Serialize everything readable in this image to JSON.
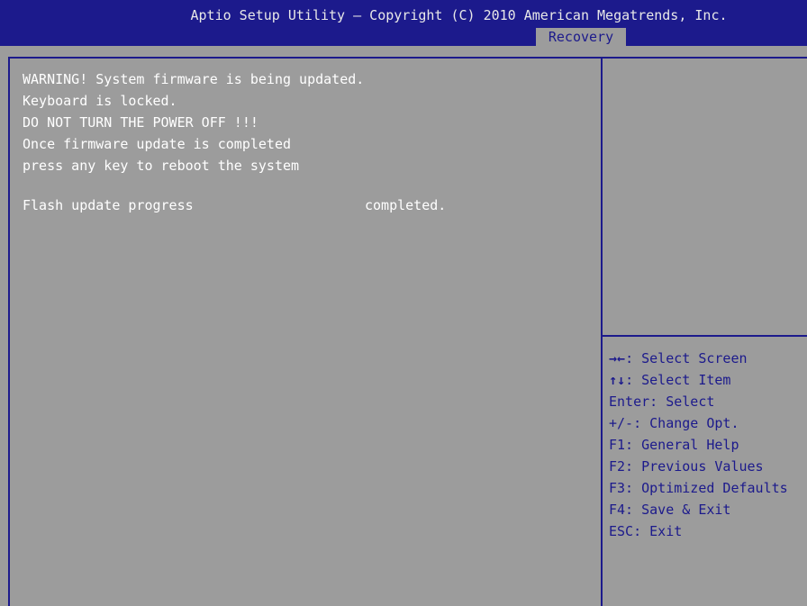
{
  "header": {
    "title": "Aptio Setup Utility – Copyright (C) 2010 American Megatrends, Inc.",
    "active_tab": "Recovery"
  },
  "main": {
    "messages": [
      "WARNING! System firmware is being updated.",
      "Keyboard is locked.",
      "DO NOT TURN THE POWER OFF !!!",
      "Once firmware update is completed",
      "press any key to reboot the system"
    ],
    "progress_label": "Flash update progress",
    "progress_value": "completed."
  },
  "help": {
    "items": [
      {
        "key": "→←",
        "text": ": Select Screen"
      },
      {
        "key": "↑↓",
        "text": ": Select Item"
      },
      {
        "key": "",
        "text": "Enter: Select"
      },
      {
        "key": "",
        "text": "+/-: Change Opt."
      },
      {
        "key": "",
        "text": "F1: General Help"
      },
      {
        "key": "",
        "text": "F2: Previous Values"
      },
      {
        "key": "",
        "text": "F3: Optimized Defaults"
      },
      {
        "key": "",
        "text": "F4: Save & Exit"
      },
      {
        "key": "",
        "text": "ESC: Exit"
      }
    ]
  },
  "colors": {
    "header_bg": "#1c1a8c",
    "panel_bg": "#9c9c9c",
    "main_text": "#ffffff",
    "help_text": "#1c1a8c"
  }
}
